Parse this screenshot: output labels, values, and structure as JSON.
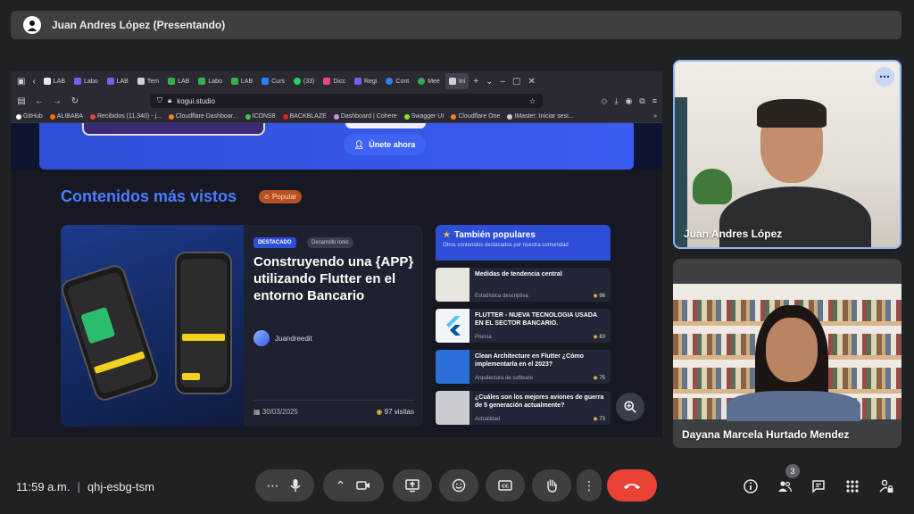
{
  "presenter": {
    "name": "Juan Andres López (Presentando)"
  },
  "browser": {
    "tabs": [
      "LAB",
      "Labo",
      "LAB",
      "Tem",
      "LAB",
      "Labo",
      "LAB",
      "Curs",
      "(33)",
      "Dicc",
      "Regi",
      "Cont",
      "Mee",
      "Ini"
    ],
    "url": "kogui.studio",
    "bookmarks": [
      "GitHub",
      "ALIBABA",
      "Recibidos (11.340) - j...",
      "Cloudflare Dashboar...",
      "ICONS8",
      "BACKBLAZE",
      "Dashboard | Cohere",
      "Swagger UI",
      "Cloudflare One",
      "IMaster: Iniciar sesi..."
    ]
  },
  "page": {
    "join_label": "Únete ahora",
    "section_title": "Contenidos más vistos",
    "popular_badge": "Popular",
    "featured": {
      "badge": "DESTACADO",
      "tag": "Desarrollo Ionic",
      "title": "Construyendo una {APP} utilizando Flutter en el entorno Bancario",
      "author": "Juandreedit",
      "date": "30/03/2025",
      "views": "97 visitas"
    },
    "sidebar": {
      "title": "También populares",
      "subtitle": "Otros contenidos destacados por nuestra comunidad",
      "items": [
        {
          "title": "Medidas de tendencia central",
          "category": "Estadística descriptiva",
          "views": "96",
          "thumb": "#e8e4de"
        },
        {
          "title": "FLUTTER - NUEVA TECNOLOGIA USADA EN EL SECTOR BANCARIO.",
          "category": "Poesía",
          "views": "83",
          "thumb": "#f2f4f8"
        },
        {
          "title": "Clean Architecture en Flutter ¿Cómo implementarla en el 2023?",
          "category": "Arquitectura de software",
          "views": "75",
          "thumb": "#2c6fd8"
        },
        {
          "title": "¿Cuáles son los mejores aviones de guerra de 5 generación actualmente?",
          "category": "Actualidad",
          "views": "73",
          "thumb": "#c9cdd2"
        }
      ]
    }
  },
  "participants": [
    {
      "name": "Juan Andres López"
    },
    {
      "name": "Dayana Marcela Hurtado Mendez"
    }
  ],
  "controls": {
    "time": "11:59 a.m.",
    "meeting_code": "qhj-esbg-tsm",
    "people_count": "3"
  },
  "colors": {
    "end_call": "#ea4335",
    "accent": "#8ab4f8",
    "page_blue": "#2d4fd8"
  }
}
